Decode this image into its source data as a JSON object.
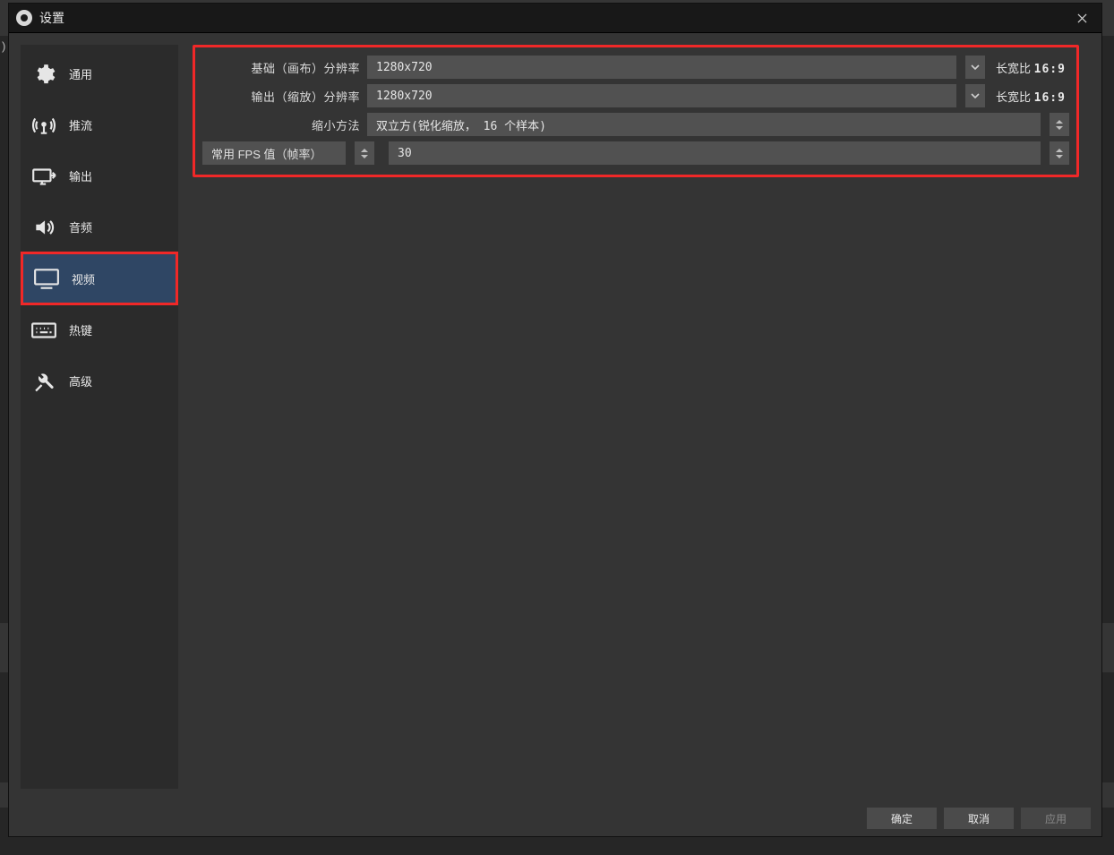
{
  "window": {
    "title": "设置"
  },
  "sidebar": {
    "items": [
      {
        "label": "通用"
      },
      {
        "label": "推流"
      },
      {
        "label": "输出"
      },
      {
        "label": "音频"
      },
      {
        "label": "视频"
      },
      {
        "label": "热键"
      },
      {
        "label": "高级"
      }
    ]
  },
  "video": {
    "base_res_label": "基础（画布）分辨率",
    "base_res_value": "1280x720",
    "base_aspect_label": "长宽比",
    "base_aspect_value": "16:9",
    "output_res_label": "输出（缩放）分辨率",
    "output_res_value": "1280x720",
    "output_aspect_label": "长宽比",
    "output_aspect_value": "16:9",
    "downscale_label": "缩小方法",
    "downscale_value": "双立方(锐化缩放， 16 个样本)",
    "fps_type_label": "常用 FPS 值（帧率）",
    "fps_value": "30"
  },
  "footer": {
    "ok": "确定",
    "cancel": "取消",
    "apply": "应用"
  },
  "leftedge": ")"
}
